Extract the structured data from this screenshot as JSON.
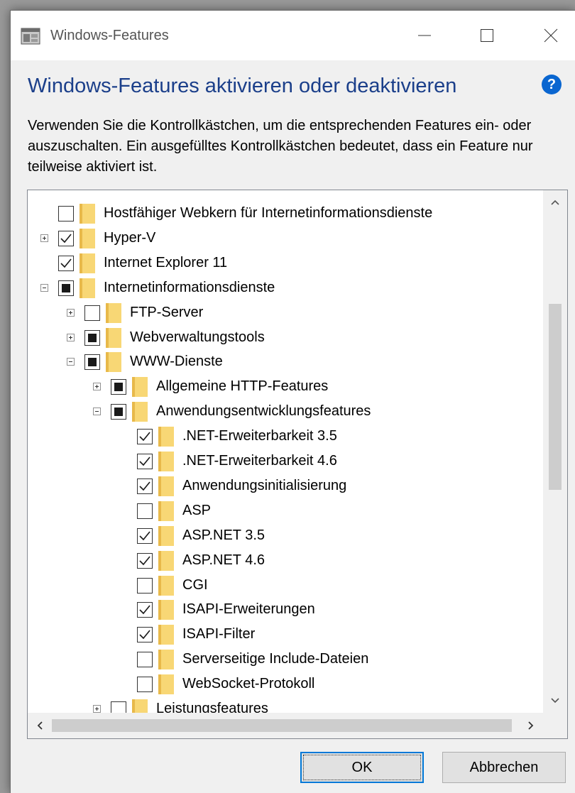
{
  "window": {
    "title": "Windows-Features",
    "heading": "Windows-Features aktivieren oder deaktivieren",
    "description": "Verwenden Sie die Kontrollkästchen, um die entsprechenden Features ein- oder auszuschalten. Ein ausgefülltes Kontrollkästchen bedeutet, dass ein Feature nur teilweise aktiviert ist.",
    "help_icon": "?"
  },
  "tree": {
    "rows": [
      {
        "label": "Hostfähiger Webkern für Internetinformationsdienste",
        "level": 0,
        "expander": "none",
        "state": "unchecked"
      },
      {
        "label": "Hyper-V",
        "level": 0,
        "expander": "plus",
        "state": "checked"
      },
      {
        "label": "Internet Explorer 11",
        "level": 0,
        "expander": "none",
        "state": "checked"
      },
      {
        "label": "Internetinformationsdienste",
        "level": 0,
        "expander": "minus",
        "state": "partial"
      },
      {
        "label": "FTP-Server",
        "level": 1,
        "expander": "plus",
        "state": "unchecked"
      },
      {
        "label": "Webverwaltungstools",
        "level": 1,
        "expander": "plus",
        "state": "partial"
      },
      {
        "label": "WWW-Dienste",
        "level": 1,
        "expander": "minus",
        "state": "partial"
      },
      {
        "label": "Allgemeine HTTP-Features",
        "level": 2,
        "expander": "plus",
        "state": "partial"
      },
      {
        "label": "Anwendungsentwicklungsfeatures",
        "level": 2,
        "expander": "minus",
        "state": "partial"
      },
      {
        "label": ".NET-Erweiterbarkeit 3.5",
        "level": 3,
        "expander": "none",
        "state": "checked"
      },
      {
        "label": ".NET-Erweiterbarkeit 4.6",
        "level": 3,
        "expander": "none",
        "state": "checked"
      },
      {
        "label": "Anwendungsinitialisierung",
        "level": 3,
        "expander": "none",
        "state": "checked"
      },
      {
        "label": "ASP",
        "level": 3,
        "expander": "none",
        "state": "unchecked"
      },
      {
        "label": "ASP.NET 3.5",
        "level": 3,
        "expander": "none",
        "state": "checked"
      },
      {
        "label": "ASP.NET 4.6",
        "level": 3,
        "expander": "none",
        "state": "checked"
      },
      {
        "label": "CGI",
        "level": 3,
        "expander": "none",
        "state": "unchecked"
      },
      {
        "label": "ISAPI-Erweiterungen",
        "level": 3,
        "expander": "none",
        "state": "checked"
      },
      {
        "label": "ISAPI-Filter",
        "level": 3,
        "expander": "none",
        "state": "checked"
      },
      {
        "label": "Serverseitige Include-Dateien",
        "level": 3,
        "expander": "none",
        "state": "unchecked"
      },
      {
        "label": "WebSocket-Protokoll",
        "level": 3,
        "expander": "none",
        "state": "unchecked"
      },
      {
        "label": "Leistungsfeatures",
        "level": 2,
        "expander": "plus",
        "state": "unchecked"
      }
    ]
  },
  "buttons": {
    "ok": "OK",
    "cancel": "Abbrechen"
  },
  "colors": {
    "heading": "#1b3f8a",
    "accent": "#0078d7",
    "folder": "#f8d775"
  },
  "icons": {
    "app": "windows-features-icon",
    "help": "help-icon",
    "folder": "folder-icon"
  }
}
